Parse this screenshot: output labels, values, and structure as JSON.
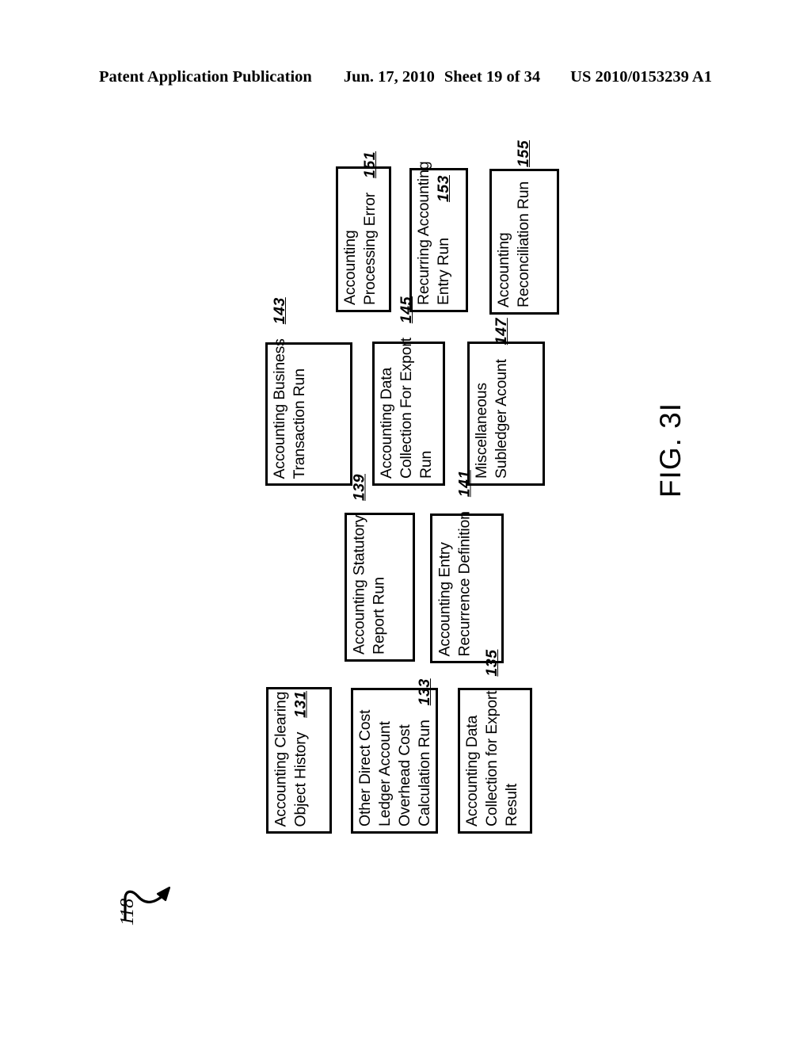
{
  "header": {
    "publication": "Patent Application Publication",
    "date": "Jun. 17, 2010",
    "sheet": "Sheet 19 of 34",
    "patent_number": "US 2010/0153239 A1"
  },
  "figure": {
    "label": "FIG. 3I",
    "callout_reference": "118",
    "callout_icon": "curved-arrow-icon",
    "boxes": [
      {
        "id": "151",
        "lines": [
          "Accounting",
          "Processing Error"
        ],
        "ref": "151"
      },
      {
        "id": "153",
        "lines": [
          "Recurring Accounting",
          "Entry Run"
        ],
        "ref": "153"
      },
      {
        "id": "155",
        "lines": [
          "Accounting",
          "Reconciliation Run"
        ],
        "ref": "155"
      },
      {
        "id": "143",
        "lines": [
          "Accounting Business",
          "Transaction Run"
        ],
        "ref": "143"
      },
      {
        "id": "145",
        "lines": [
          "Accounting Data",
          "Collection For Export",
          "Run"
        ],
        "ref": "145"
      },
      {
        "id": "147",
        "lines": [
          "Miscellaneous",
          "Subledger Acount"
        ],
        "ref": "147"
      },
      {
        "id": "139",
        "lines": [
          "Accounting Statutory",
          "Report Run"
        ],
        "ref": "139"
      },
      {
        "id": "141",
        "lines": [
          "Accounting Entry",
          "Recurrence Definition"
        ],
        "ref": "141"
      },
      {
        "id": "131",
        "lines": [
          "Accounting Clearing",
          "Object History"
        ],
        "ref": "131"
      },
      {
        "id": "133",
        "lines": [
          "Other Direct Cost",
          "Ledger Account",
          "Overhead Cost",
          "Calculation Run"
        ],
        "ref": "133"
      },
      {
        "id": "135",
        "lines": [
          "Accounting Data",
          "Collection for Export",
          "Result"
        ],
        "ref": "135"
      }
    ]
  },
  "colors": {
    "ink": "#000000",
    "paper": "#ffffff"
  }
}
